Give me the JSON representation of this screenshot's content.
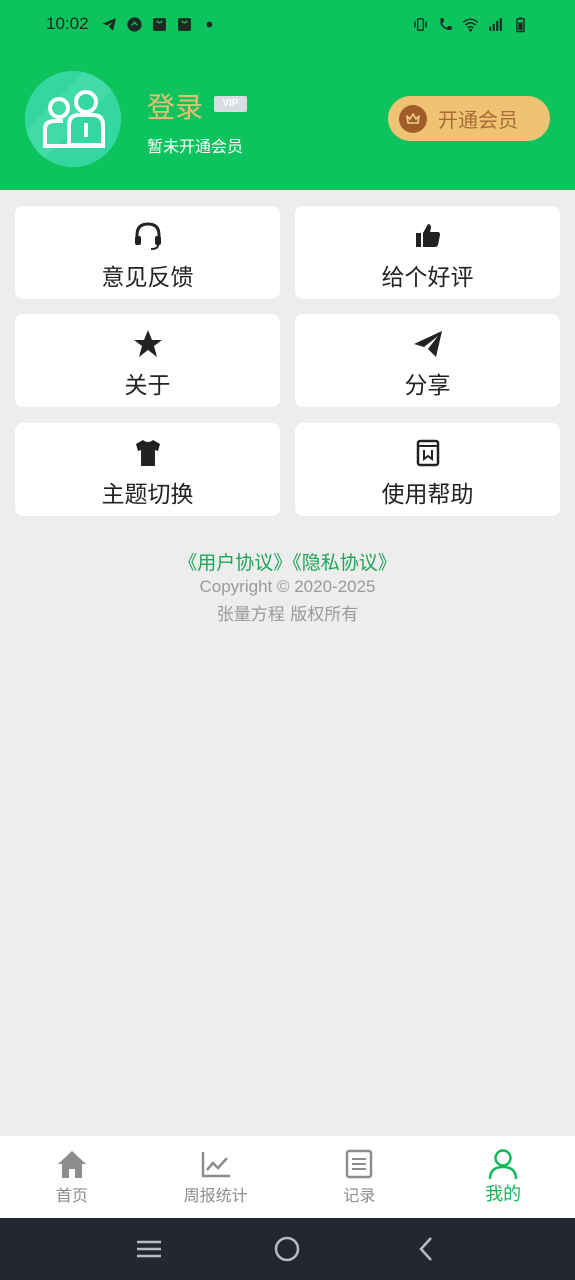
{
  "status_bar": {
    "time": "10:02",
    "left_icons": [
      "telegram-icon",
      "chat-bubble-icon",
      "shopping-bag-icon",
      "shopping-bag-icon",
      "dot-icon"
    ],
    "right_icons": [
      "vibrate-icon",
      "wifi-call-icon",
      "wifi-icon",
      "signal-icon",
      "battery-icon"
    ]
  },
  "header": {
    "login_label": "登录",
    "vip_badge": "VIP",
    "member_status": "暂未开通会员",
    "open_member_label": "开通会员",
    "accent_color": "#0cc35e",
    "gold_color": "#eec474"
  },
  "menu": [
    {
      "label": "意见反馈",
      "icon": "headset-icon"
    },
    {
      "label": "给个好评",
      "icon": "thumbs-up-icon"
    },
    {
      "label": "关于",
      "icon": "star-icon"
    },
    {
      "label": "分享",
      "icon": "paper-plane-icon"
    },
    {
      "label": "主题切换",
      "icon": "tshirt-icon"
    },
    {
      "label": "使用帮助",
      "icon": "book-icon"
    }
  ],
  "footer": {
    "user_agreement": "《用户协议》",
    "privacy_policy": "《隐私协议》",
    "copyright": "Copyright © 2020-2025",
    "rights": "张量方程  版权所有"
  },
  "bottom_nav": {
    "items": [
      {
        "label": "首页",
        "icon": "home-icon",
        "active": false
      },
      {
        "label": "周报统计",
        "icon": "line-chart-icon",
        "active": false
      },
      {
        "label": "记录",
        "icon": "list-document-icon",
        "active": false
      },
      {
        "label": "我的",
        "icon": "person-icon",
        "active": true
      }
    ]
  },
  "system_nav": [
    "menu-icon",
    "home-circle-icon",
    "back-icon"
  ]
}
